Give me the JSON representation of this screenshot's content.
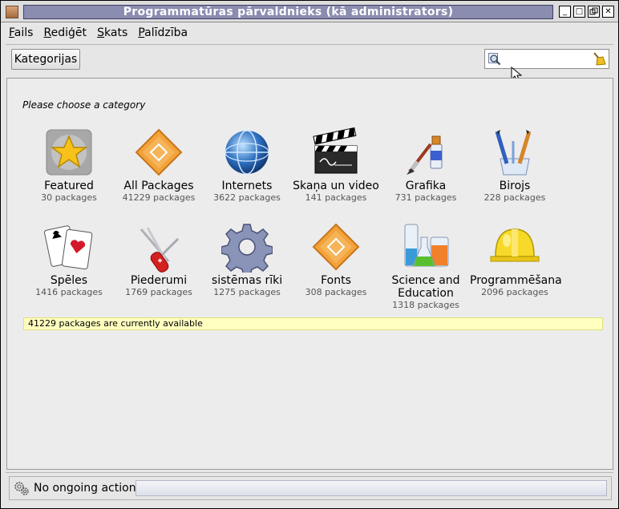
{
  "window": {
    "title": "Programmatūras pārvaldnieks (kā administrators)",
    "controls": [
      "_",
      "□",
      "✕"
    ]
  },
  "menu": {
    "items": [
      {
        "first": "F",
        "rest": "ails"
      },
      {
        "first": "R",
        "rest": "ediģēt"
      },
      {
        "first": "S",
        "rest": "kats"
      },
      {
        "first": "P",
        "rest": "alīdzība"
      }
    ]
  },
  "toolbar": {
    "categories_label": "Kategorijas",
    "search_value": ""
  },
  "main": {
    "prompt": "Please choose a category",
    "categories": [
      {
        "icon": "star-icon",
        "name": "Featured",
        "count": "30 packages"
      },
      {
        "icon": "package-icon",
        "name": "All Packages",
        "count": "41229 packages"
      },
      {
        "icon": "globe-icon",
        "name": "Internets",
        "count": "3622 packages"
      },
      {
        "icon": "clapperboard-icon",
        "name": "Skaņa un video",
        "count": "141 packages"
      },
      {
        "icon": "paintbrush-icon",
        "name": "Grafika",
        "count": "731 packages"
      },
      {
        "icon": "pencils-icon",
        "name": "Birojs",
        "count": "228 packages"
      },
      {
        "icon": "cards-icon",
        "name": "Spēles",
        "count": "1416 packages"
      },
      {
        "icon": "knife-icon",
        "name": "Piederumi",
        "count": "1769 packages"
      },
      {
        "icon": "gear-icon",
        "name": "sistēmas rīki",
        "count": "1275 packages"
      },
      {
        "icon": "fonts-package-icon",
        "name": "Fonts",
        "count": "308 packages"
      },
      {
        "icon": "flasks-icon",
        "name": "Science and Education",
        "count": "1318 packages"
      },
      {
        "icon": "hardhat-icon",
        "name": "Programmēšana",
        "count": "2096 packages"
      }
    ],
    "available": "41229 packages are currently available"
  },
  "status": {
    "text": "No ongoing actions"
  }
}
